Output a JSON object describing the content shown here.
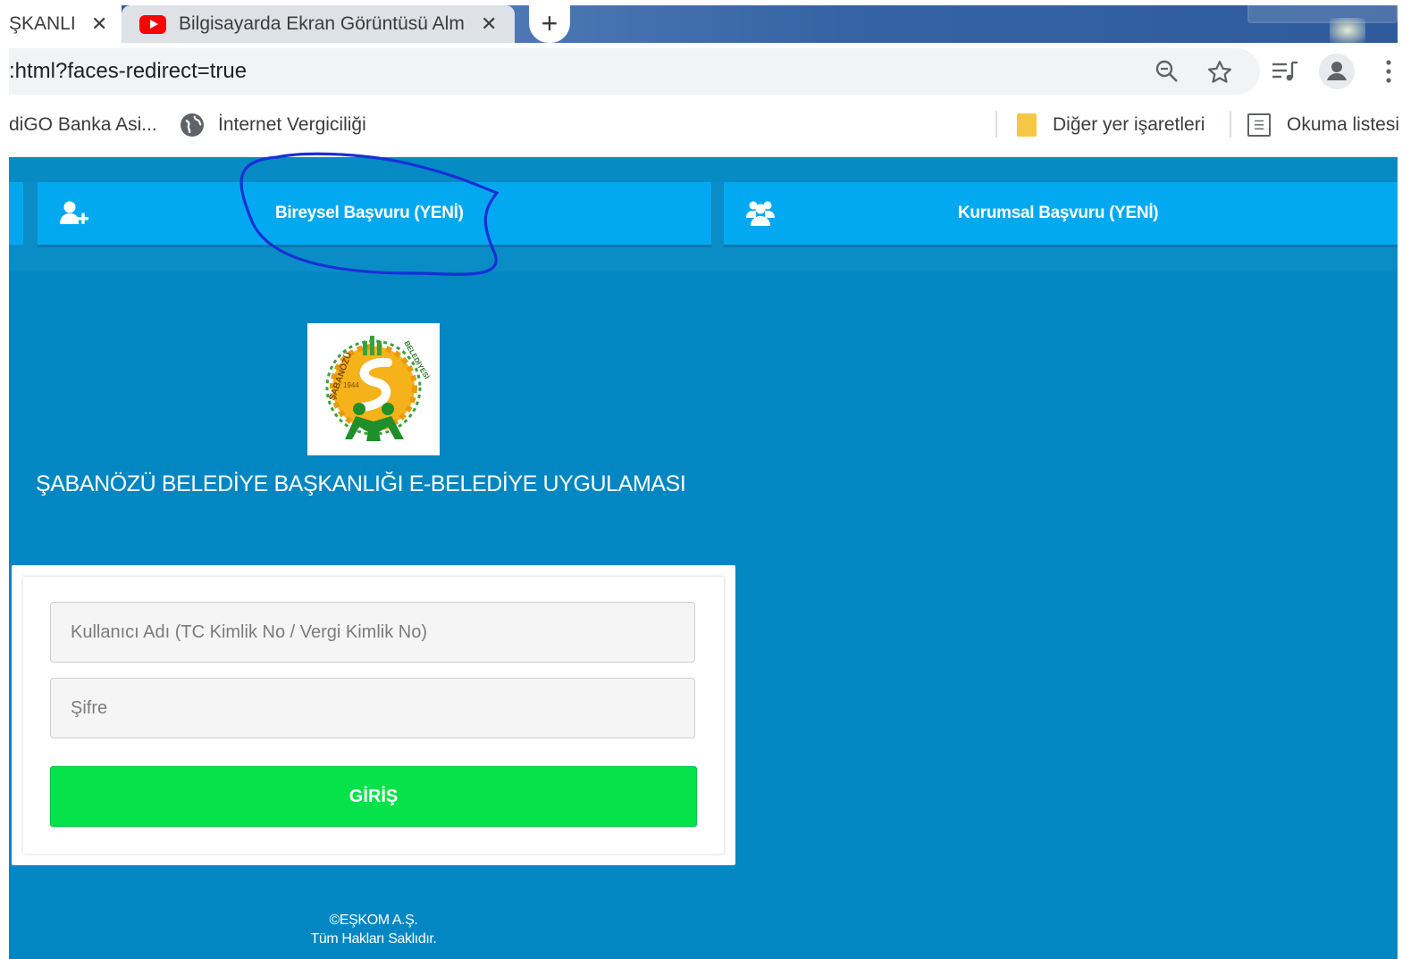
{
  "browser": {
    "tabs": [
      {
        "title": "ŞKANLIĞ",
        "close": "✕"
      },
      {
        "title": "Bilgisayarda Ekran Görüntüsü Alma",
        "close": "✕"
      }
    ],
    "new_tab": "+",
    "url": ":html?faces-redirect=true",
    "bookmarks": [
      {
        "label": "diGO Banka Asi..."
      },
      {
        "label": "İnternet Vergiciliği"
      },
      {
        "label": "Diğer yer işaretleri"
      },
      {
        "label": "Okuma listesi"
      }
    ]
  },
  "nav": {
    "individual": "Bireysel Başvuru (YENİ)",
    "corporate": "Kurumsal Başvuru (YENİ)"
  },
  "logo": {
    "text_top": "ŞABANÖZÜ",
    "text_side": "BELEDİYESİ",
    "year": "1944"
  },
  "app_title": "ŞABANÖZÜ BELEDİYE BAŞKANLIĞI E-BELEDİYE UYGULAMASI",
  "login": {
    "username_placeholder": "Kullanıcı Adı (TC Kimlik No / Vergi Kimlik No)",
    "password_placeholder": "Şifre",
    "submit": "GİRİŞ"
  },
  "footer": {
    "copyright": "©EŞKOM A.Ş.",
    "rights": "Tüm Hakları Saklıdır."
  },
  "colors": {
    "page_bg": "#0287c2",
    "nav_button": "#03a9f0",
    "login_button": "#06e24a",
    "annotation": "#1a2fd6"
  }
}
